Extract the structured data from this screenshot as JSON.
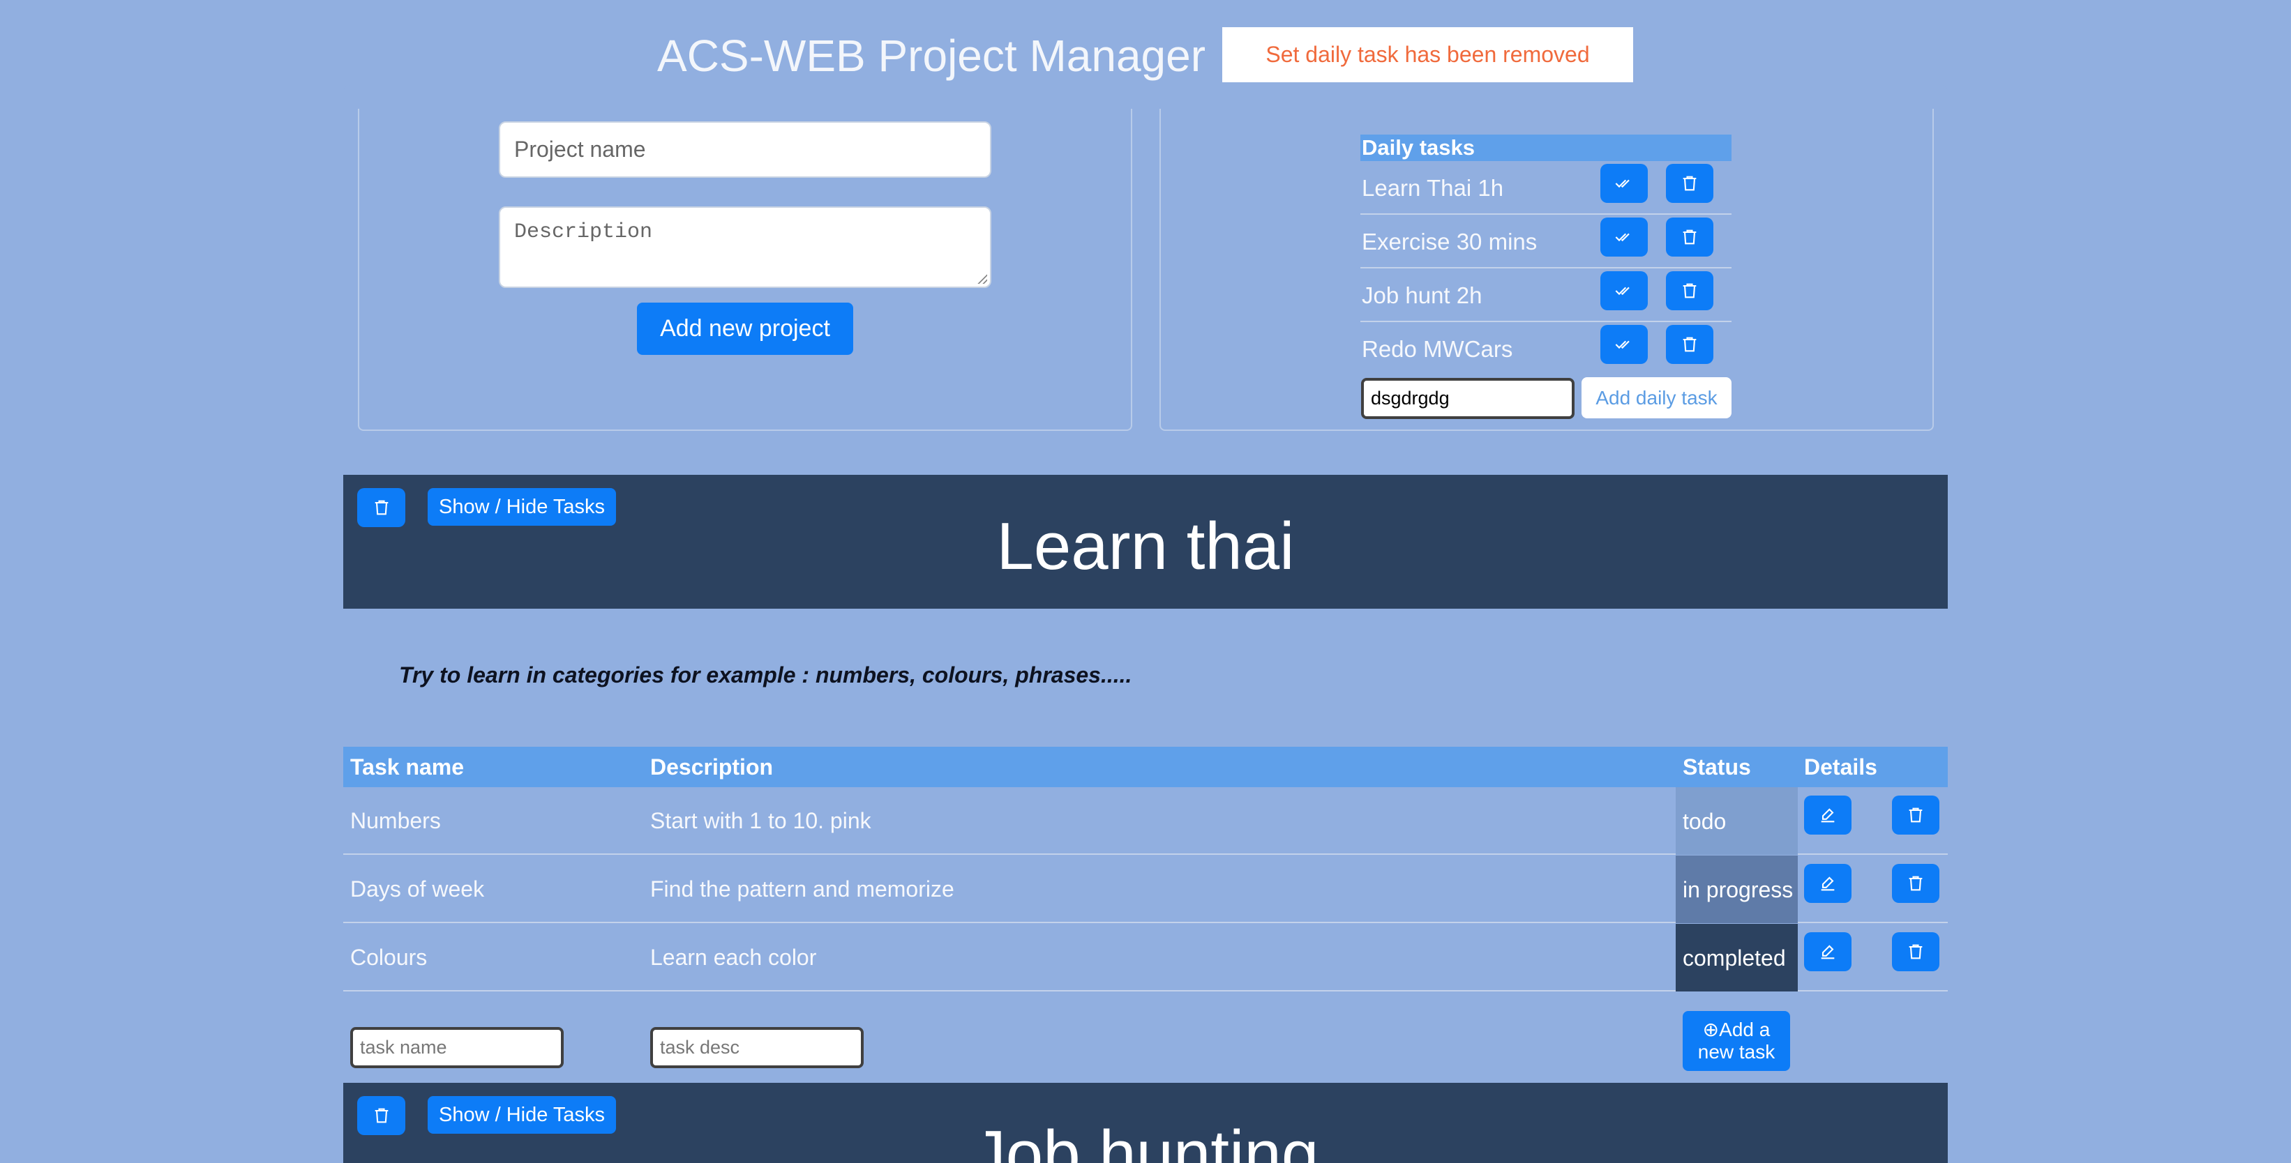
{
  "header": {
    "title": "ACS-WEB Project Manager",
    "toast": "Set daily task has been removed"
  },
  "new_project": {
    "name_placeholder": "Project name",
    "description_placeholder": "Description",
    "add_button": "Add new project"
  },
  "daily": {
    "heading": "Daily tasks",
    "tasks": [
      {
        "label": "Learn Thai 1h"
      },
      {
        "label": "Exercise 30 mins"
      },
      {
        "label": "Job hunt 2h"
      },
      {
        "label": "Redo MWCars"
      }
    ],
    "input_value": "dsgdrgdg",
    "add_button": "Add daily task"
  },
  "projects": [
    {
      "title": "Learn thai",
      "toggle_label": "Show / Hide Tasks",
      "description": "Try to learn in categories for example : numbers, colours, phrases.....",
      "columns": [
        "Task name",
        "Description",
        "Status",
        "Details"
      ],
      "tasks": [
        {
          "name": "Numbers",
          "description": "Start with 1 to 10. pink",
          "status": "todo"
        },
        {
          "name": "Days of week",
          "description": "Find the pattern and memorize",
          "status": "in progress"
        },
        {
          "name": "Colours",
          "description": "Learn each color",
          "status": "completed"
        }
      ],
      "new_task_name_placeholder": "task name",
      "new_task_desc_placeholder": "task desc",
      "add_task_label_1": "Add a",
      "add_task_label_2": "new task"
    },
    {
      "title": "Job hunting",
      "toggle_label": "Show / Hide Tasks"
    }
  ],
  "colors": {
    "background": "#91afe0",
    "primary": "#0d7cf7",
    "header_dark": "#2c4260",
    "table_header": "#5fa0ea",
    "toast_text": "#f06a3c"
  }
}
